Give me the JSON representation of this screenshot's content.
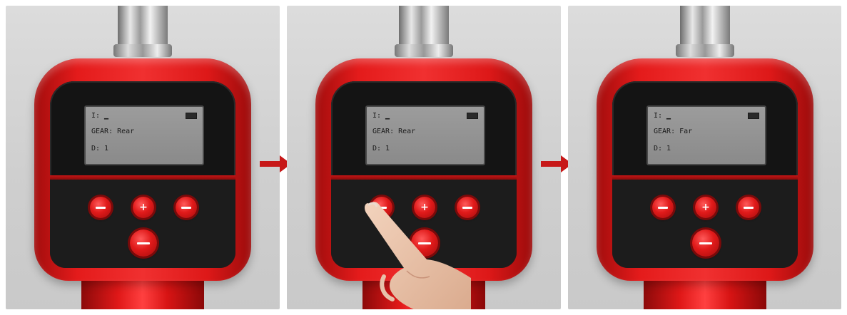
{
  "panels": [
    {
      "label": "step-1",
      "lcd": {
        "line1": "I: ▁",
        "line2": "GEAR: Rear",
        "line3": "D: 1"
      },
      "finger": false
    },
    {
      "label": "step-2",
      "lcd": {
        "line1": "I: ▁",
        "line2": "GEAR: Rear",
        "line3": "D: 1"
      },
      "finger": true
    },
    {
      "label": "step-3",
      "lcd": {
        "line1": "I: ▁",
        "line2": "GEAR: Far",
        "line3": "D: 1"
      },
      "finger": false
    }
  ],
  "buttons": {
    "menu_icon": "menu-icon",
    "plus_icon": "plus-icon",
    "minus_icon": "minus-icon",
    "enter_icon": "enter-icon"
  },
  "colors": {
    "device_red": "#e01a1a",
    "arrow_red": "#c71818",
    "lcd_background": "#949494"
  }
}
